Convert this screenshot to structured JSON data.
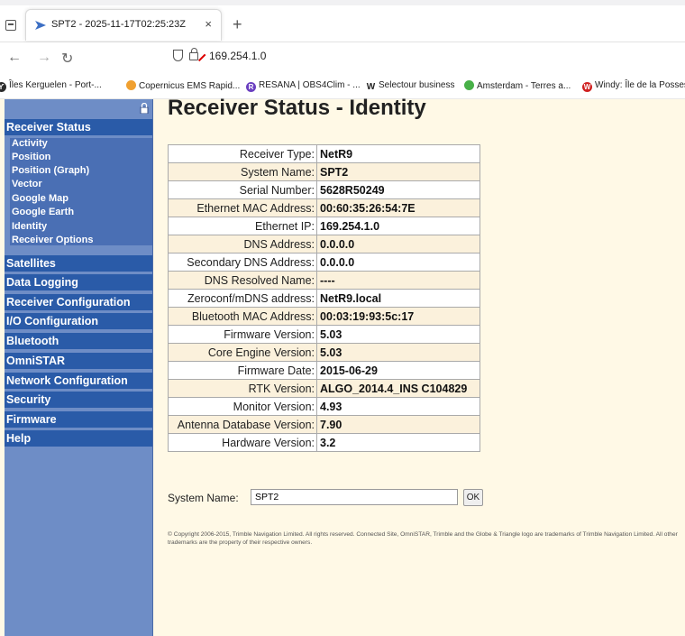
{
  "browser": {
    "tab_title": "SPT2 - 2025-11-17T02:25:23Z",
    "tab_close": "×",
    "new_tab": "+",
    "url": "169.254.1.0",
    "bookmarks": [
      {
        "label": "Îles Kerguelen - Port-...",
        "icon": "Y",
        "color": "#2b2b2b"
      },
      {
        "label": "Copernicus EMS Rapid...",
        "icon": "",
        "color": "#f0a030"
      },
      {
        "label": "RESANA | OBS4Clim - ...",
        "icon": "R",
        "color": "#6a3fc0"
      },
      {
        "label": "Selectour business",
        "icon": "W",
        "color": "#ffffff"
      },
      {
        "label": "Amsterdam - Terres a...",
        "icon": "",
        "color": "#48b048"
      },
      {
        "label": "Windy: Île de la Posses",
        "icon": "W",
        "color": "#d02020"
      }
    ]
  },
  "sidebar": {
    "sections": [
      {
        "label": "Receiver Status"
      },
      {
        "label": "Satellites"
      },
      {
        "label": "Data Logging"
      },
      {
        "label": "Receiver Configuration"
      },
      {
        "label": "I/O Configuration"
      },
      {
        "label": "Bluetooth"
      },
      {
        "label": "OmniSTAR"
      },
      {
        "label": "Network Configuration"
      },
      {
        "label": "Security"
      },
      {
        "label": "Firmware"
      },
      {
        "label": "Help"
      }
    ],
    "subitems": [
      {
        "label": "Activity"
      },
      {
        "label": "Position"
      },
      {
        "label": "Position (Graph)"
      },
      {
        "label": "Vector"
      },
      {
        "label": "Google Map"
      },
      {
        "label": "Google Earth"
      },
      {
        "label": "Identity"
      },
      {
        "label": "Receiver Options"
      }
    ]
  },
  "main": {
    "title": "Receiver Status - Identity",
    "rows": [
      {
        "label": "Receiver Type:",
        "value": "NetR9"
      },
      {
        "label": "System Name:",
        "value": "SPT2"
      },
      {
        "label": "Serial Number:",
        "value": "5628R50249"
      },
      {
        "label": "Ethernet MAC Address:",
        "value": "00:60:35:26:54:7E"
      },
      {
        "label": "Ethernet IP:",
        "value": "169.254.1.0"
      },
      {
        "label": "DNS Address:",
        "value": "0.0.0.0"
      },
      {
        "label": "Secondary DNS Address:",
        "value": "0.0.0.0"
      },
      {
        "label": "DNS Resolved Name:",
        "value": "----"
      },
      {
        "label": "Zeroconf/mDNS address:",
        "value": "NetR9.local"
      },
      {
        "label": "Bluetooth MAC Address:",
        "value": "00:03:19:93:5c:17"
      },
      {
        "label": "Firmware Version:",
        "value": "5.03"
      },
      {
        "label": "Core Engine Version:",
        "value": "5.03"
      },
      {
        "label": "Firmware Date:",
        "value": "2015-06-29"
      },
      {
        "label": "RTK Version:",
        "value": "ALGO_2014.4_INS C104829"
      },
      {
        "label": "Monitor Version:",
        "value": "4.93"
      },
      {
        "label": "Antenna Database Version:",
        "value": "7.90"
      },
      {
        "label": "Hardware Version:",
        "value": "3.2"
      }
    ],
    "form": {
      "label": "System Name:",
      "value": "SPT2",
      "ok_label": "OK"
    },
    "copyright": "© Copyright 2006-2015, Trimble Navigation Limited. All rights reserved. Connected Site, OmniSTAR, Trimble and the Globe & Triangle logo are trademarks of Trimble Navigation Limited. All other trademarks are the property of their respective owners."
  }
}
